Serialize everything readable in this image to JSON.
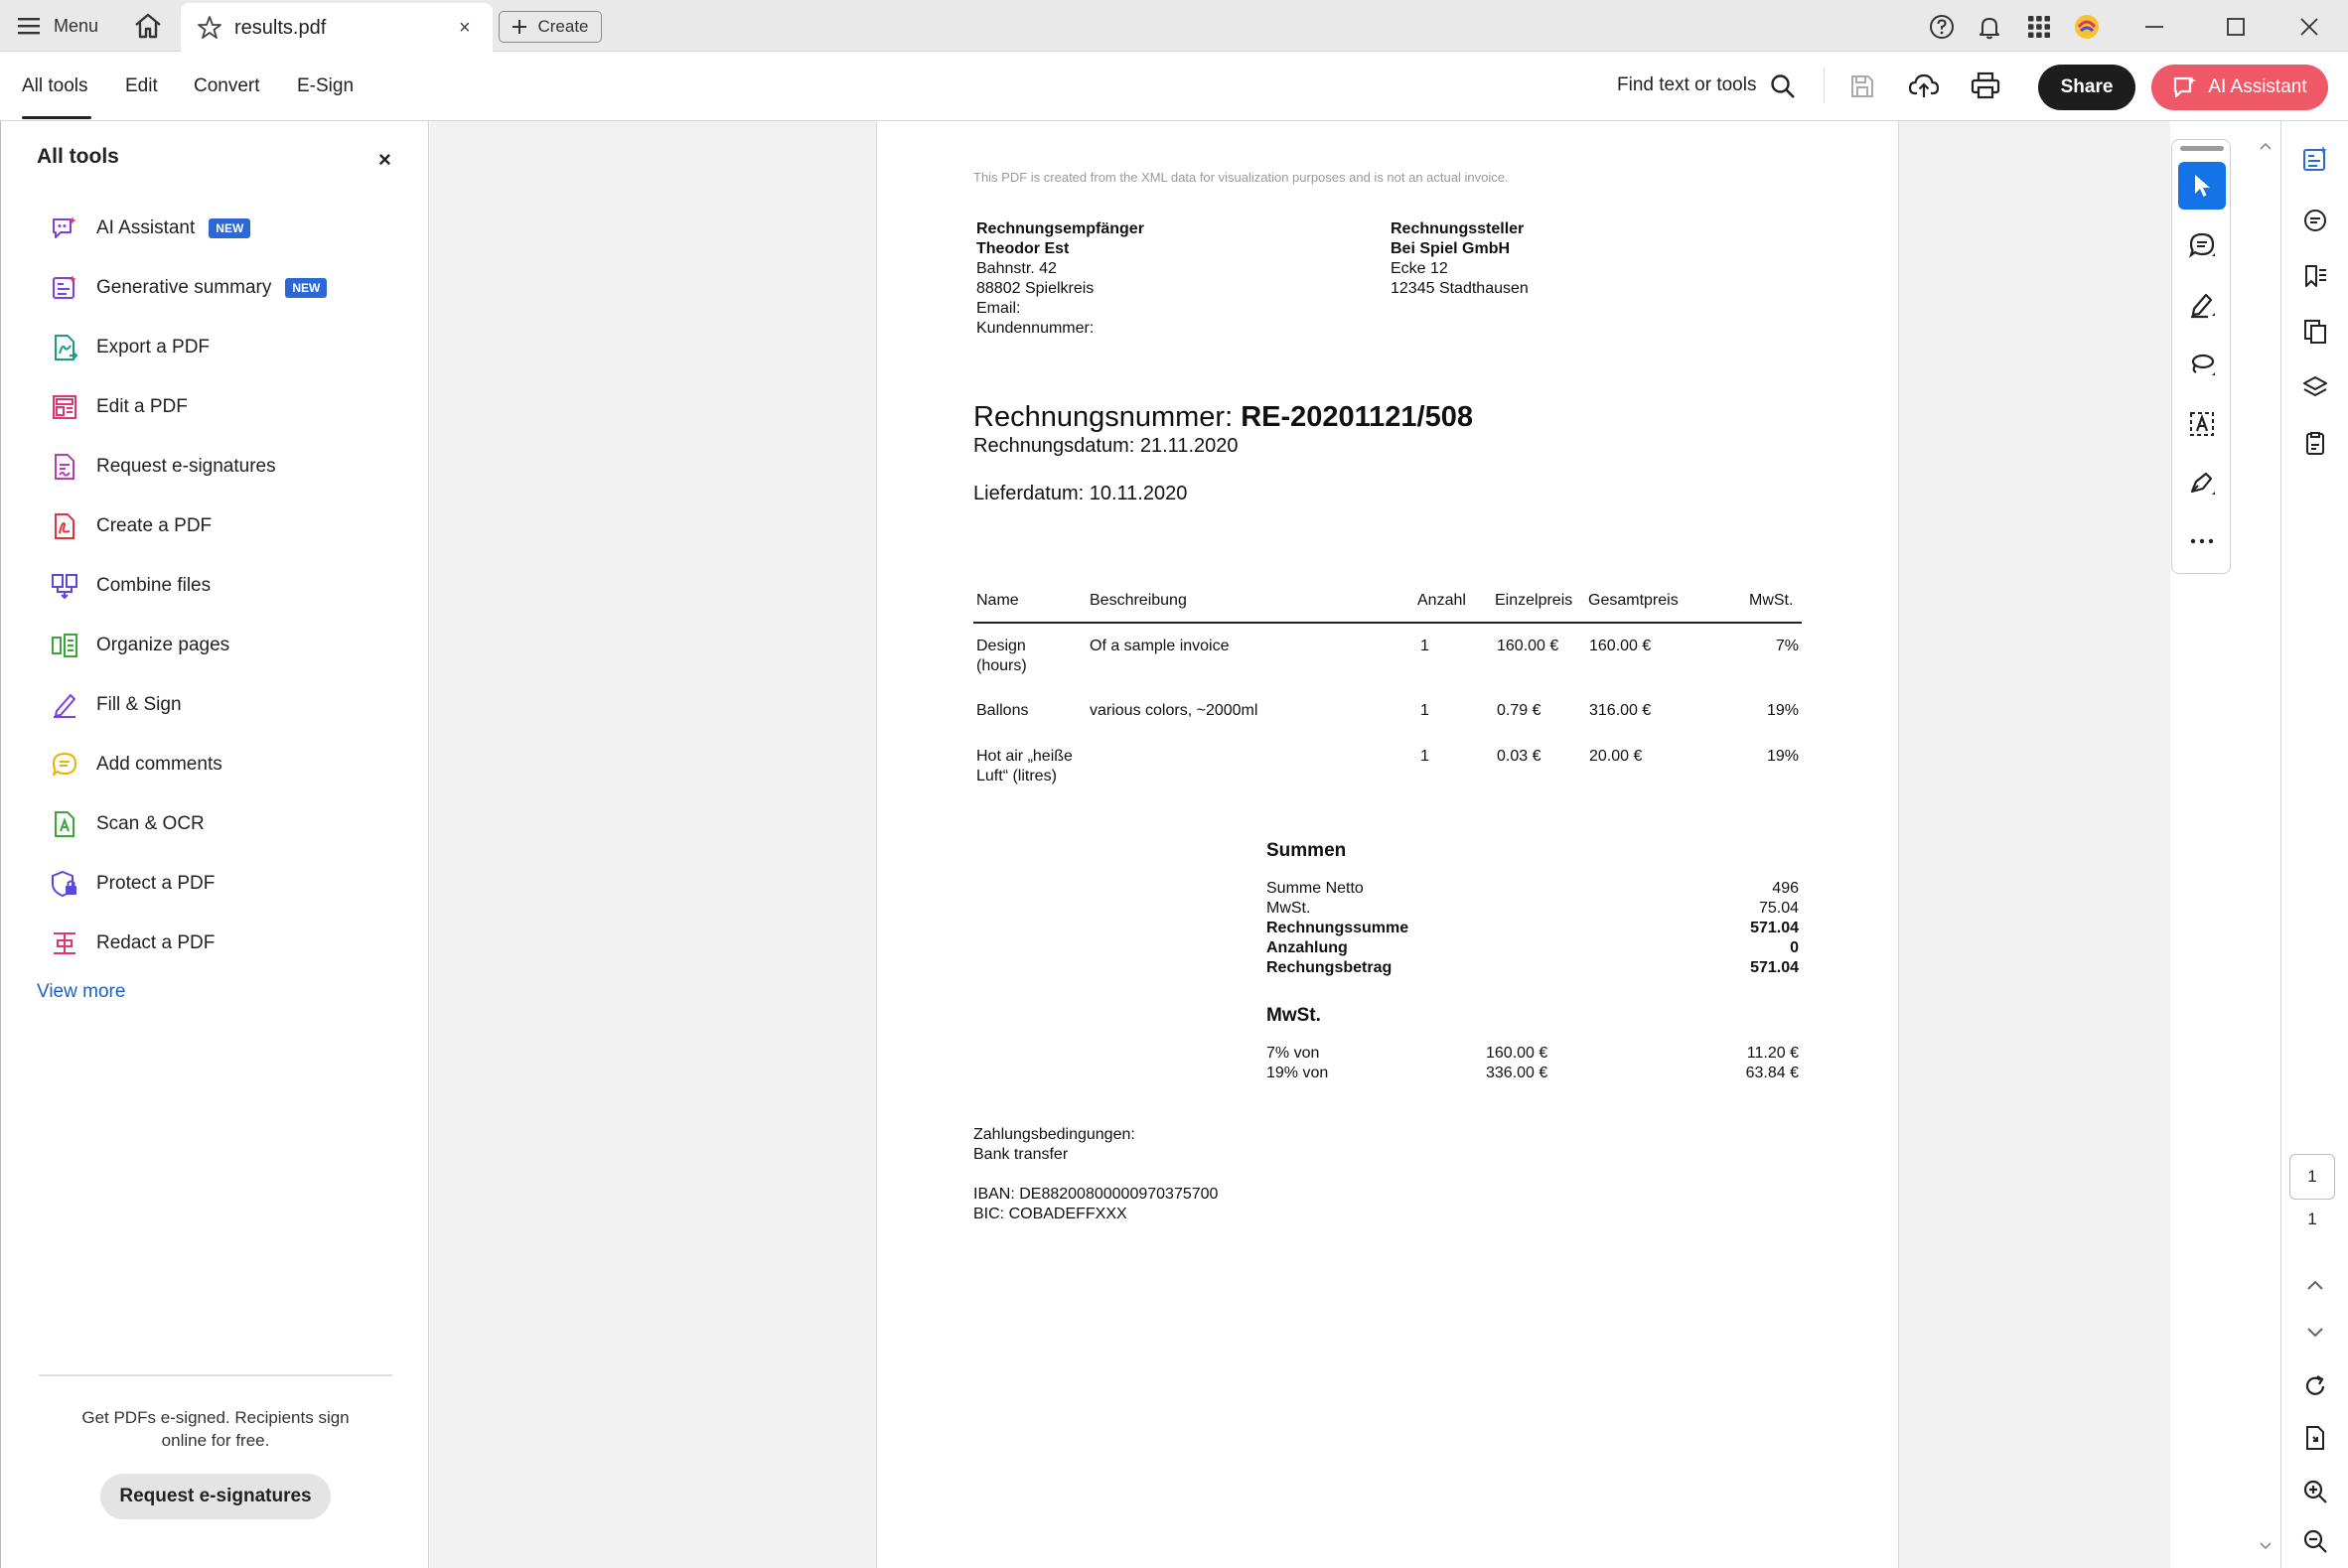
{
  "titlebar": {
    "menu_label": "Menu",
    "tab_title": "results.pdf",
    "tab_close": "×",
    "create_label": "Create"
  },
  "toolbar": {
    "tabs": [
      "All tools",
      "Edit",
      "Convert",
      "E-Sign"
    ],
    "find_label": "Find text or tools",
    "share_label": "Share",
    "ai_label": "AI Assistant"
  },
  "left_panel": {
    "title": "All tools",
    "close": "×",
    "tools": [
      {
        "label": "AI Assistant",
        "badge": "NEW",
        "icon": "ai-assistant-icon",
        "color": "#7b3fe4"
      },
      {
        "label": "Generative summary",
        "badge": "NEW",
        "icon": "generative-summary-icon",
        "color": "#7b3fe4"
      },
      {
        "label": "Export a PDF",
        "badge": "",
        "icon": "export-pdf-icon",
        "color": "#1b9a8a"
      },
      {
        "label": "Edit a PDF",
        "badge": "",
        "icon": "edit-pdf-icon",
        "color": "#e0346d"
      },
      {
        "label": "Request e-signatures",
        "badge": "",
        "icon": "request-esign-icon",
        "color": "#b03fb0"
      },
      {
        "label": "Create a PDF",
        "badge": "",
        "icon": "create-pdf-icon",
        "color": "#e0343c"
      },
      {
        "label": "Combine files",
        "badge": "",
        "icon": "combine-files-icon",
        "color": "#5a49d8"
      },
      {
        "label": "Organize pages",
        "badge": "",
        "icon": "organize-pages-icon",
        "color": "#3aa63a"
      },
      {
        "label": "Fill & Sign",
        "badge": "",
        "icon": "fill-sign-icon",
        "color": "#7b3fe4"
      },
      {
        "label": "Add comments",
        "badge": "",
        "icon": "add-comments-icon",
        "color": "#e6b400"
      },
      {
        "label": "Scan & OCR",
        "badge": "",
        "icon": "scan-ocr-icon",
        "color": "#3aa63a"
      },
      {
        "label": "Protect a PDF",
        "badge": "",
        "icon": "protect-pdf-icon",
        "color": "#5a49d8"
      },
      {
        "label": "Redact a PDF",
        "badge": "",
        "icon": "redact-pdf-icon",
        "color": "#e0346d"
      }
    ],
    "view_more": "View more",
    "promo_text": "Get PDFs e-signed. Recipients sign online for free.",
    "promo_button": "Request e-signatures"
  },
  "invoice": {
    "disclaimer": "This PDF is created from the XML data for visualization purposes and is not an actual invoice.",
    "recipient": {
      "heading": "Rechnungsempfänger",
      "name": "Theodor Est",
      "street": "Bahnstr. 42",
      "city": "88802 Spielkreis",
      "email": "Email:",
      "customer_no": "Kundennummer:"
    },
    "sender": {
      "heading": "Rechnungssteller",
      "name": "Bei Spiel GmbH",
      "street": "Ecke 12",
      "city": "12345 Stadthausen"
    },
    "number_label": "Rechnungsnummer: ",
    "number_value": "RE-20201121/508",
    "date": "Rechnungsdatum: 21.11.2020",
    "delivery": "Lieferdatum: 10.11.2020",
    "table_headers": [
      "Name",
      "Beschreibung",
      "Anzahl",
      "Einzelpreis",
      "Gesamtpreis",
      "MwSt."
    ],
    "rows": [
      {
        "name1": "Design",
        "name2": "(hours)",
        "desc": "Of a sample invoice",
        "qty": "1",
        "unit": "160.00 €",
        "total": "160.00 €",
        "vat": "7%"
      },
      {
        "name1": "Ballons",
        "name2": "",
        "desc": "various colors, ~2000ml",
        "qty": "1",
        "unit": "0.79 €",
        "total": "316.00 €",
        "vat": "19%"
      },
      {
        "name1": "Hot air „heiße",
        "name2": "Luft“ (litres)",
        "desc": "",
        "qty": "1",
        "unit": "0.03 €",
        "total": "20.00 €",
        "vat": "19%"
      }
    ],
    "sums_heading": "Summen",
    "sums": [
      {
        "label": "Summe Netto",
        "value": "496",
        "bold": false
      },
      {
        "label": "MwSt.",
        "value": "75.04",
        "bold": false
      },
      {
        "label": "Rechnungssumme",
        "value": "571.04",
        "bold": true
      },
      {
        "label": "Anzahlung",
        "value": "0",
        "bold": true
      },
      {
        "label": "Rechungsbetrag",
        "value": "571.04",
        "bold": true
      }
    ],
    "vat_heading": "MwSt.",
    "vat_rows": [
      {
        "label": "7% von",
        "base": "160.00 €",
        "amount": "11.20 €"
      },
      {
        "label": "19% von",
        "base": "336.00 €",
        "amount": "63.84 €"
      }
    ],
    "payment_label": "Zahlungsbedingungen:",
    "payment_method": "Bank transfer",
    "iban": "IBAN: DE88200800000970375700",
    "bic": "BIC: COBADEFFXXX"
  },
  "right_rail": {
    "page_current": "1",
    "page_total": "1"
  }
}
